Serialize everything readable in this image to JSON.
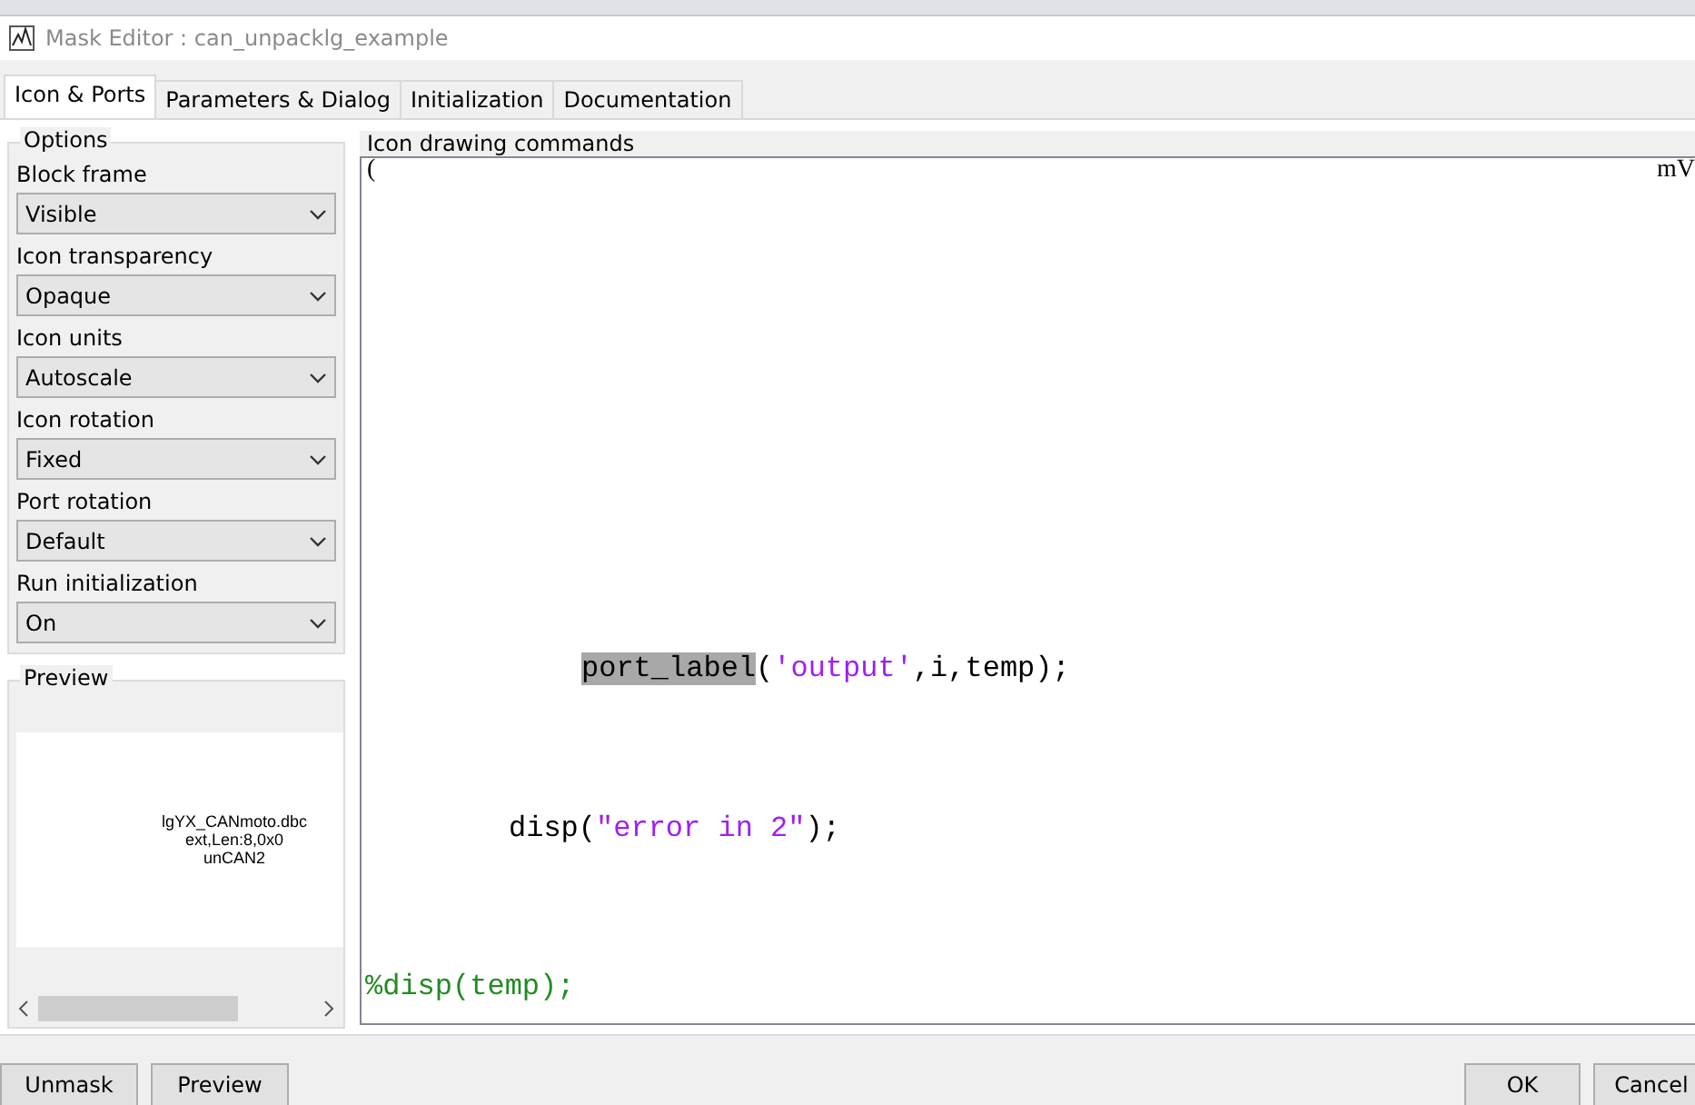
{
  "window": {
    "title": "Mask Editor : can_unpacklg_example"
  },
  "tabs": [
    {
      "label": "Icon & Ports",
      "selected": true
    },
    {
      "label": "Parameters & Dialog",
      "selected": false
    },
    {
      "label": "Initialization",
      "selected": false
    },
    {
      "label": "Documentation",
      "selected": false
    }
  ],
  "options": {
    "title": "Options",
    "fields": [
      {
        "label": "Block frame",
        "value": "Visible"
      },
      {
        "label": "Icon transparency",
        "value": "Opaque"
      },
      {
        "label": "Icon units",
        "value": "Autoscale"
      },
      {
        "label": "Icon rotation",
        "value": "Fixed"
      },
      {
        "label": "Port rotation",
        "value": "Default"
      },
      {
        "label": "Run initialization",
        "value": "On"
      }
    ]
  },
  "preview": {
    "title": "Preview",
    "lines": [
      "lgYX_CANmoto.dbc",
      "ext,Len:8,0x0",
      "unCAN2"
    ]
  },
  "editor": {
    "title": "Icon drawing commands",
    "first_line": {
      "left": "(",
      "right": "mV"
    },
    "lines": [
      [
        {
          "text": "port_label",
          "kind": "highlight"
        },
        {
          "text": "(",
          "kind": "plain"
        },
        {
          "text": "'output'",
          "kind": "string"
        },
        {
          "text": ",i,temp);",
          "kind": "plain"
        }
      ],
      [
        {
          "text": "disp(",
          "kind": "plain"
        },
        {
          "text": "\"error in 2\"",
          "kind": "string"
        },
        {
          "text": ");",
          "kind": "plain"
        }
      ],
      [
        {
          "text": "%disp(temp);",
          "kind": "comment"
        }
      ]
    ]
  },
  "buttons_left": [
    "Unmask",
    "Preview"
  ],
  "buttons_right": [
    "OK",
    "Cancel"
  ]
}
